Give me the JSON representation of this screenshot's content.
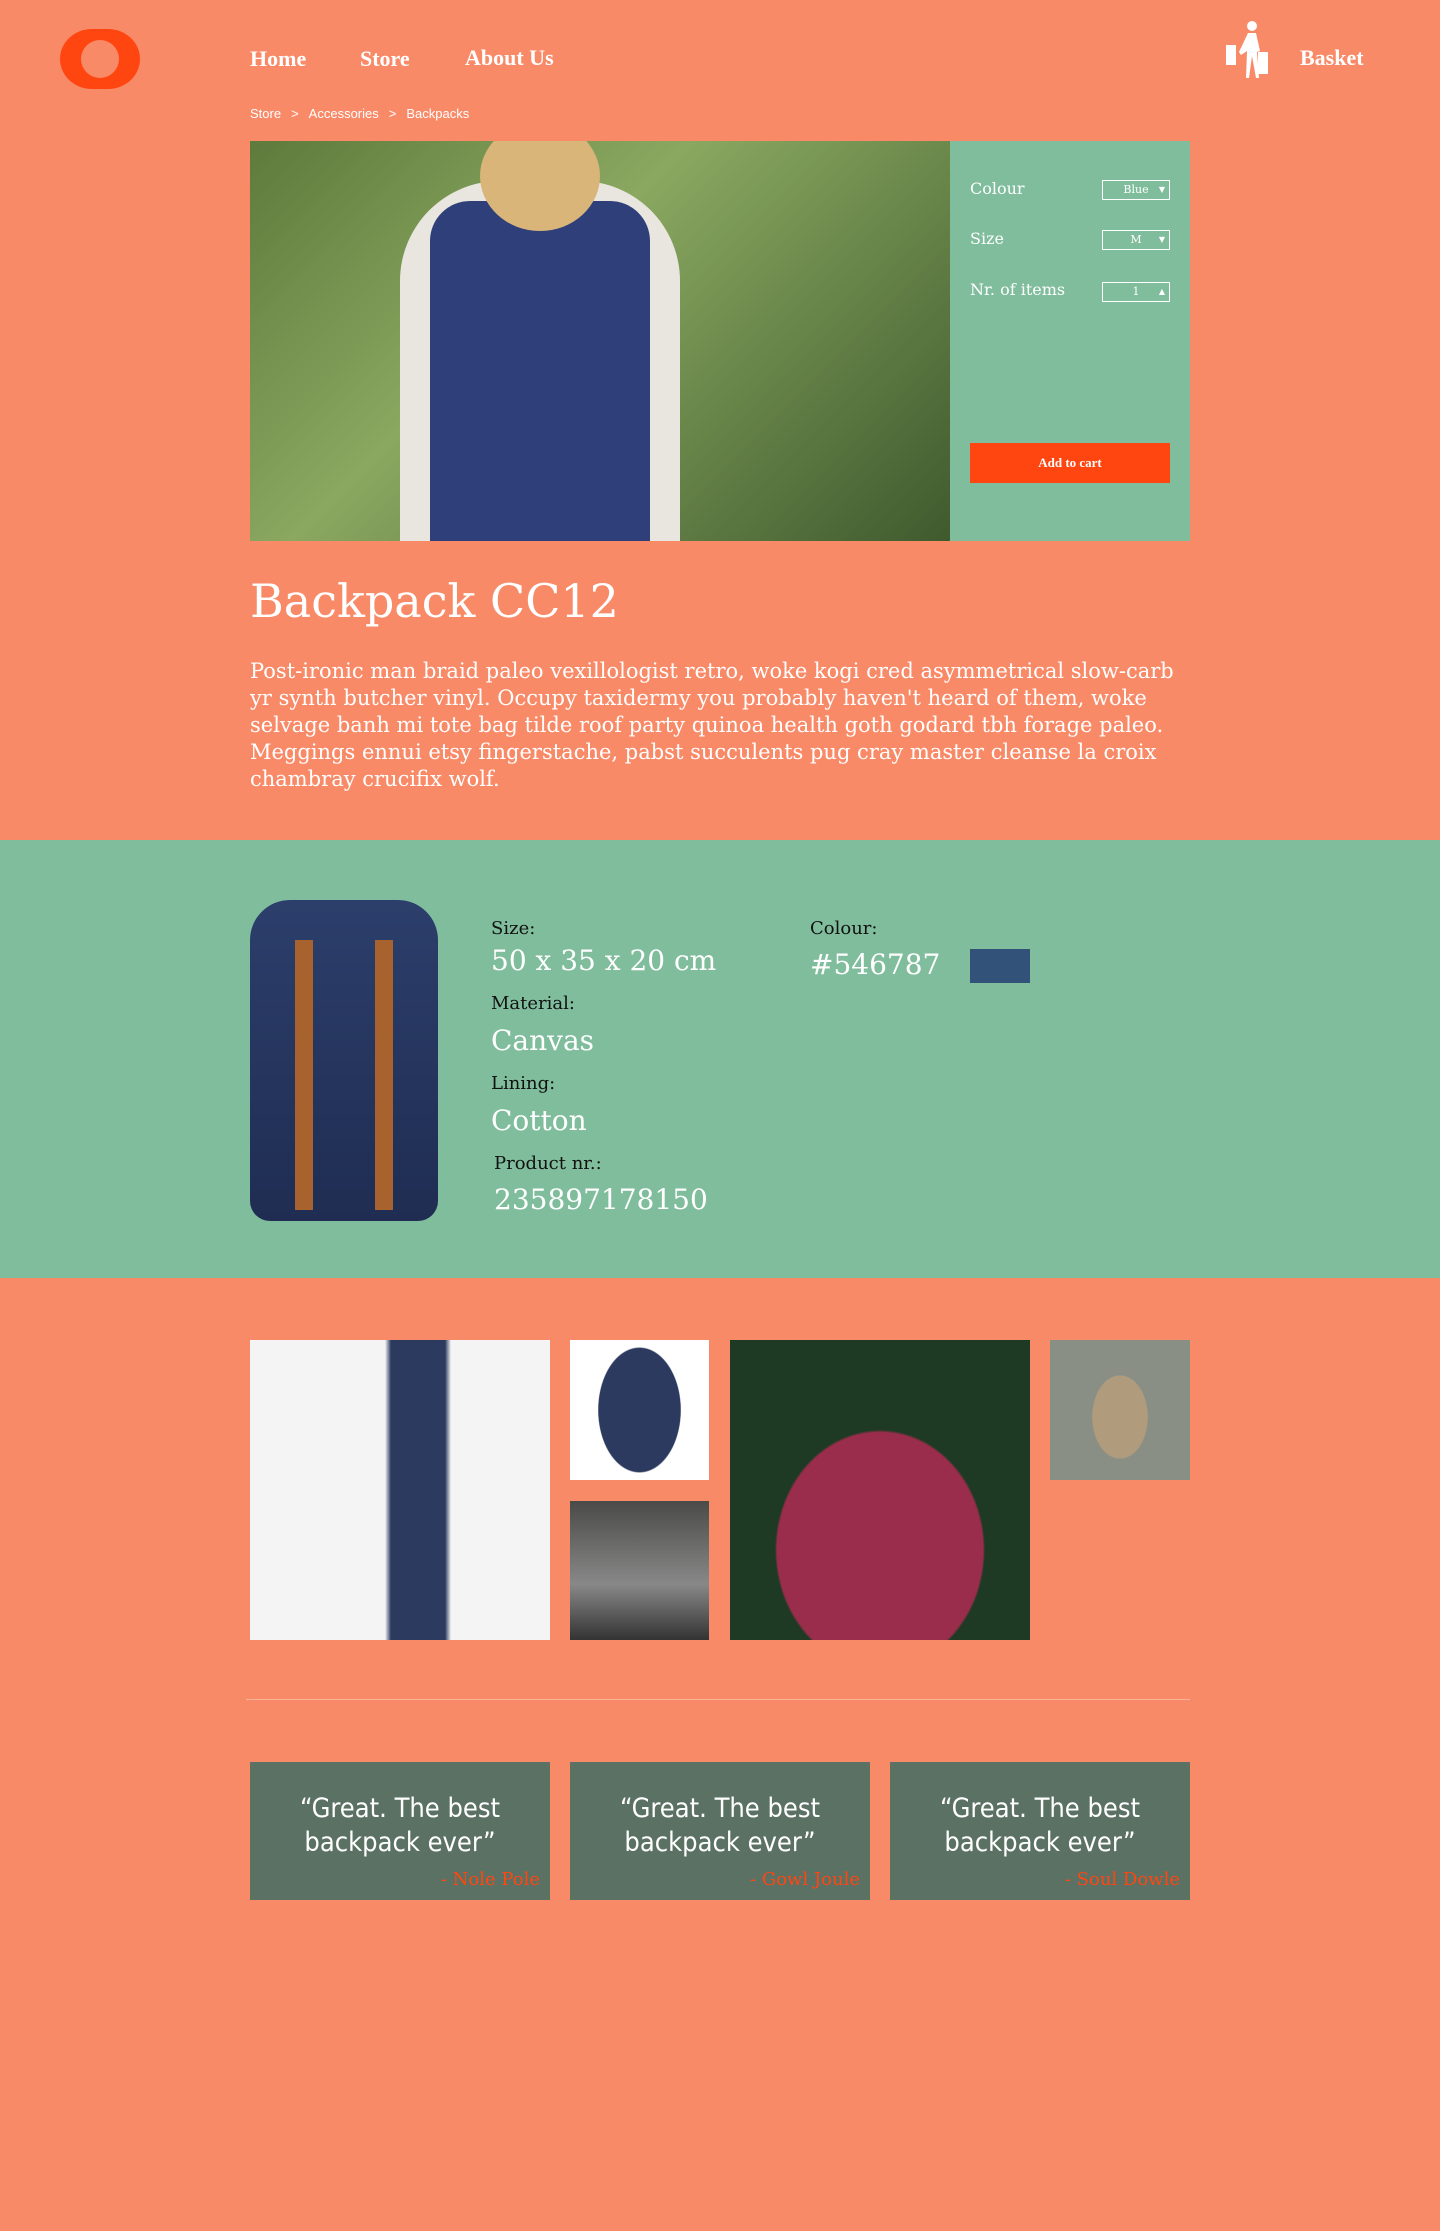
{
  "header": {
    "nav": [
      "Home",
      "Store",
      "About Us"
    ],
    "basket_label": "Basket",
    "breadcrumb": [
      "Store",
      ">",
      "Accessories",
      ">",
      "Backpacks"
    ]
  },
  "options": {
    "colour_label": "Colour",
    "colour_value": "Blue",
    "size_label": "Size",
    "size_value": "M",
    "items_label": "Nr. of items",
    "items_value": "1",
    "add_to_cart": "Add to cart"
  },
  "product": {
    "title": "Backpack CC12",
    "description": "Post-ironic man braid paleo vexillologist retro, woke kogi cred asymmetrical slow-carb yr synth butcher vinyl. Occupy taxidermy you probably haven't heard of them, woke selvage banh mi tote bag tilde roof party quinoa health goth godard tbh forage paleo. Meggings ennui etsy fingerstache, pabst succulents pug cray master cleanse la croix chambray crucifix wolf."
  },
  "specs": {
    "size_label": "Size:",
    "size": "50 x 35 x 20 cm",
    "material_label": "Material:",
    "material": "Canvas",
    "lining_label": "Lining:",
    "lining": "Cotton",
    "product_nr_label": "Product nr.:",
    "product_nr": "235897178150",
    "colour_label": "Colour:",
    "colour": "#546787",
    "swatch_color": "#33527a"
  },
  "testimonials": [
    {
      "quote": "“Great. The best backpack ever”",
      "author": "- Nole Pole"
    },
    {
      "quote": "“Great. The best backpack ever”",
      "author": "- Gowl Joule"
    },
    {
      "quote": "“Great. The best backpack ever”",
      "author": "- Soul Dowle"
    }
  ],
  "colors": {
    "background": "#f98a68",
    "accent": "#ff4611",
    "green": "#80bd9d",
    "card": "#5a7164"
  }
}
